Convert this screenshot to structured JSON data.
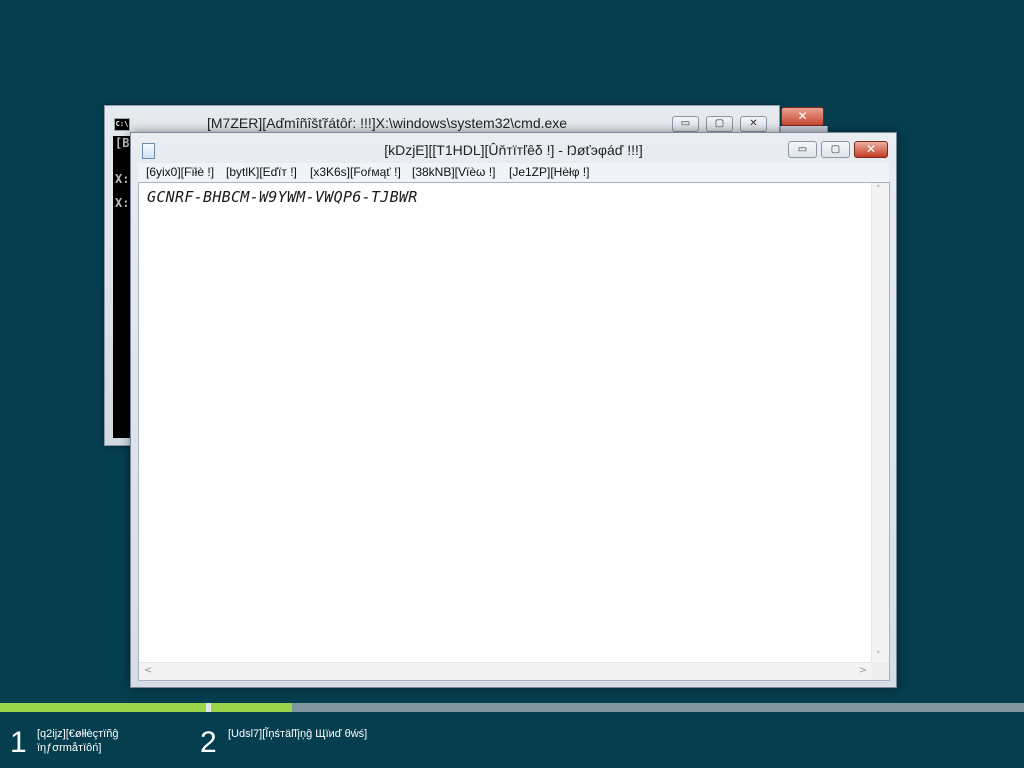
{
  "cmd_window": {
    "title": "[M7ZER][Αďmîñîšťřátôŕ:  !!!]X:\\windows\\system32\\cmd.exe",
    "icon": "cmd-icon",
    "min_glyph": "▭",
    "max_glyph": "▢",
    "close_glyph": "✕",
    "console_lines": [
      "[B",
      "X:",
      "X:"
    ],
    "icon_text": "C:\\"
  },
  "notepad": {
    "title": "[kDzjE][[T1HDL][Ûňтïтľêδ !] - Ŋøťэφáď !!!]",
    "icon": "notepad-icon",
    "min_glyph": "▭",
    "max_glyph": "▢",
    "close_glyph": "✕",
    "menu": [
      {
        "label": "[6yix0][Fїłè !]"
      },
      {
        "label": "[bytlK][Eďїт !]"
      },
      {
        "label": "[x3K6s][Foŕмąť !]"
      },
      {
        "label": "[38kNB][Vïèω !]"
      },
      {
        "label": "[Je1ZP][Hèłφ !]"
      }
    ],
    "content": "GCNRF-BHBCM-W9YWM-VWQP6-TJBWR"
  },
  "setup_progress": {
    "step1": {
      "number": "1",
      "label_line1": "[q2ijz][€øłłèçтïñĝ",
      "label_line2": "ïηƒσrmåтïôń]",
      "progress": 1.0
    },
    "step2": {
      "number": "2",
      "label": "[Udsl7][Ĩņśтäľľįņĝ Щïиď θẃś]",
      "progress": 0.1
    },
    "colors": {
      "complete": "#9bd34a",
      "track": "#7f969f",
      "background": "#053e4f"
    }
  }
}
